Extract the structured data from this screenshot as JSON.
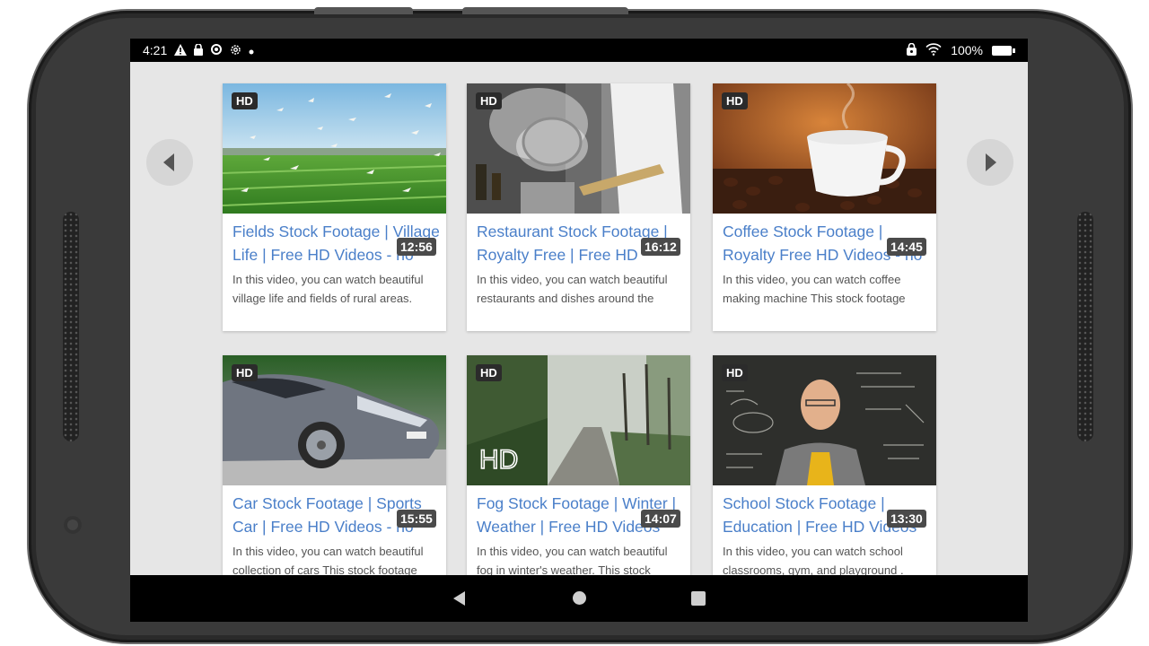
{
  "status_bar": {
    "time": "4:21",
    "battery_text": "100%"
  },
  "cards": [
    {
      "hd_label": "HD",
      "title": "Fields Stock Footage | Village Life | Free HD Videos - no copyright",
      "duration": "12:56",
      "description": "In this video, you can watch beautiful village life and fields of rural areas."
    },
    {
      "hd_label": "HD",
      "title": "Restaurant Stock Footage | Royalty Free | Free HD Videos",
      "duration": "16:12",
      "description": "In this video, you can watch beautiful restaurants and dishes around the world."
    },
    {
      "hd_label": "HD",
      "title": "Coffee Stock Footage | Royalty Free HD Videos - no copyright",
      "duration": "14:45",
      "description": "In this video, you can watch coffee making machine This stock footage"
    },
    {
      "hd_label": "HD",
      "title": "Car Stock Footage | Sports Car | Free HD Videos - no copyright",
      "duration": "15:55",
      "description": "In this video, you can watch beautiful collection of cars This stock footage"
    },
    {
      "hd_label": "HD",
      "title": "Fog Stock Footage | Winter | Weather | Free HD Videos",
      "duration": "14:07",
      "description": "In this video, you can watch beautiful fog in winter's weather. This stock"
    },
    {
      "hd_label": "HD",
      "title": "School Stock Footage | Education | Free HD Videos",
      "duration": "13:30",
      "description": "In this video, you can watch school classrooms, gym, and playground ."
    }
  ],
  "thumb_overlay_text": "HD",
  "colors": {
    "title_link": "#4a7fc9",
    "screen_bg": "#e6e6e6",
    "badge_bg": "#2b2b2b"
  },
  "icons": {
    "status_left": [
      "warning-icon",
      "lock-icon",
      "cast-icon",
      "settings-icon",
      "dot-icon"
    ],
    "status_right": [
      "lock-icon",
      "wifi-icon",
      "battery-icon"
    ],
    "nav": [
      "back-icon",
      "home-icon",
      "recents-icon"
    ],
    "carousel": [
      "chevron-left-icon",
      "chevron-right-icon"
    ]
  }
}
